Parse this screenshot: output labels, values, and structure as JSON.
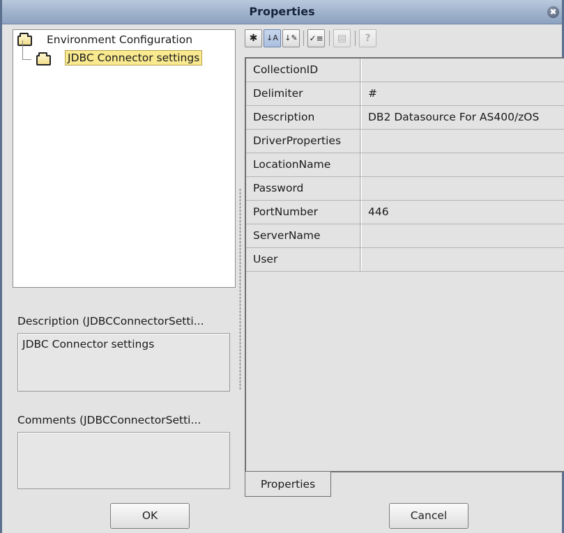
{
  "window": {
    "title": "Properties",
    "close_glyph": "✖"
  },
  "tree": {
    "root_label": "Environment Configuration",
    "child_label": "JDBC Connector settings"
  },
  "description": {
    "label": "Description (JDBCConnectorSetti...",
    "value": "JDBC Connector settings"
  },
  "comments": {
    "label": "Comments (JDBCConnectorSetti...",
    "value": ""
  },
  "toolbar": {
    "buttons": [
      {
        "icon": "expand-collapse-icon",
        "glyph": "✱"
      },
      {
        "icon": "sort-alphabetical-icon",
        "glyph": "↓A"
      },
      {
        "icon": "sort-by-category-icon",
        "glyph": "↓✎"
      },
      {
        "icon": "show-modified-icon",
        "glyph": "✓≡"
      },
      {
        "icon": "property-pages-icon",
        "glyph": "▤"
      },
      {
        "icon": "help-icon",
        "glyph": "?"
      }
    ]
  },
  "properties": [
    {
      "name": "CollectionID",
      "value": ""
    },
    {
      "name": "Delimiter",
      "value": "#"
    },
    {
      "name": "Description",
      "value": "DB2 Datasource For AS400/zOS"
    },
    {
      "name": "DriverProperties",
      "value": ""
    },
    {
      "name": "LocationName",
      "value": ""
    },
    {
      "name": "Password",
      "value": ""
    },
    {
      "name": "PortNumber",
      "value": "446"
    },
    {
      "name": "ServerName",
      "value": ""
    },
    {
      "name": "User",
      "value": ""
    }
  ],
  "tab_label": "Properties",
  "buttons": {
    "ok": "OK",
    "cancel": "Cancel"
  },
  "colors": {
    "title_bar": "#9fb2cc",
    "selection": "#f9e98f",
    "panel": "#e3e3e3"
  }
}
